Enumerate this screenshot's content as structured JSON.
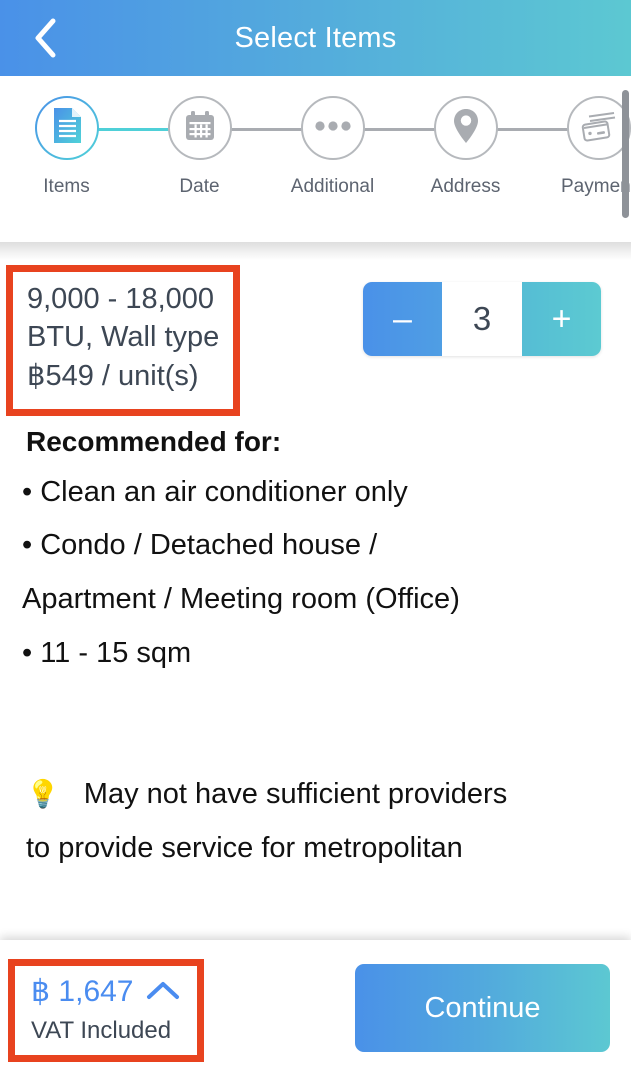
{
  "header": {
    "title": "Select Items",
    "back_icon": "chevron-left-icon",
    "gradient_from": "#4a91e8",
    "gradient_to": "#5cc8d2"
  },
  "stepper": {
    "active_index": 0,
    "active_color": "#4fd0d8",
    "inactive_color": "#a9acb1",
    "steps": [
      {
        "label": "Items",
        "icon": "document-icon",
        "state": "active"
      },
      {
        "label": "Date",
        "icon": "calendar-icon",
        "state": "inactive"
      },
      {
        "label": "Additional",
        "icon": "ellipsis-icon",
        "state": "inactive"
      },
      {
        "label": "Address",
        "icon": "location-pin-icon",
        "state": "inactive"
      },
      {
        "label": "Payment",
        "icon": "credit-cards-icon",
        "state": "inactive"
      }
    ]
  },
  "item": {
    "desc_line1": "9,000 - 18,000",
    "desc_line2": "BTU,  Wall type",
    "desc_line3": "฿549 / unit(s)",
    "highlighted": true,
    "highlight_color": "#e8431f"
  },
  "quantity": {
    "minus_label": "–",
    "value": "3",
    "plus_label": "+"
  },
  "recommended": {
    "title": "Recommended for:",
    "items": [
      "• Clean an air conditioner only",
      "• Condo / Detached house /",
      "Apartment / Meeting room (Office)",
      "• 11 - 15 sqm"
    ]
  },
  "notice": {
    "icon": "💡",
    "line1": "May not have sufficient providers",
    "line2": "to provide service for metropolitan"
  },
  "bottom": {
    "currency_amount": "฿ 1,647",
    "expand_icon": "chevron-up-icon",
    "vat_label": "VAT Included",
    "continue_label": "Continue",
    "highlighted": true,
    "highlight_color": "#e8431f",
    "amount_color": "#4a8cf0"
  }
}
